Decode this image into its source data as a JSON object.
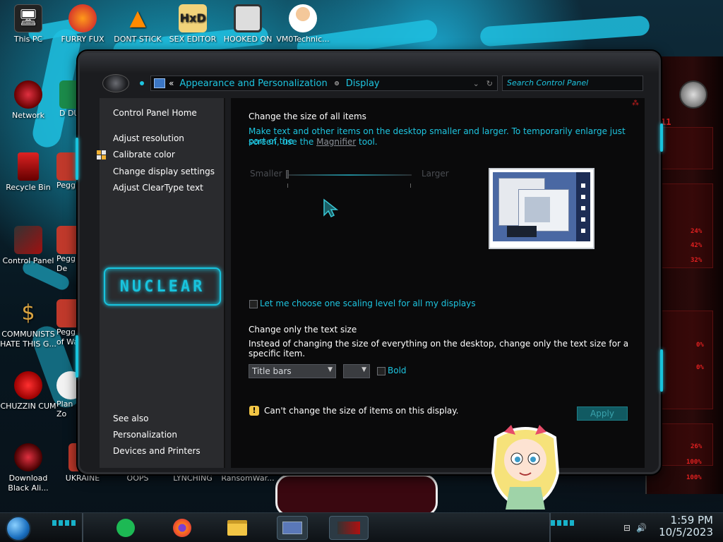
{
  "desktop": {
    "icons": [
      {
        "label": "This PC"
      },
      {
        "label": "FURRY FUX"
      },
      {
        "label": "DONT STICK"
      },
      {
        "label": "SEX EDITOR"
      },
      {
        "label": "HOOKED ON"
      },
      {
        "label": "VM0Technic..."
      },
      {
        "label": "Network"
      },
      {
        "label": "D DUM"
      },
      {
        "label": "Recycle Bin"
      },
      {
        "label": "Peggle"
      },
      {
        "label": "Control Panel"
      },
      {
        "label": "Peggle De"
      },
      {
        "label": "COMMUNISTS HATE THIS G..."
      },
      {
        "label": "Peggle of Wa"
      },
      {
        "label": "CHUZZIN CUM"
      },
      {
        "label": "Plan Zo"
      },
      {
        "label": "Download Black Ali..."
      },
      {
        "label": "UKRAINE"
      },
      {
        "label": "OOPS"
      },
      {
        "label": "LYNCHING"
      },
      {
        "label": "RansomWar..."
      }
    ],
    "wallpaper_readouts": [
      "24%",
      "42%",
      "32%",
      "0%",
      "0%",
      "26%",
      "100%",
      "100%"
    ],
    "wallpaper_number": "11"
  },
  "window": {
    "address": {
      "separator": "«",
      "crumb_1": "Appearance and Personalization",
      "crumb_2": "Display",
      "dropdown_glyph": "⌄",
      "refresh_glyph": "↻"
    },
    "search": {
      "placeholder": "Search Control Panel"
    },
    "sidebar": {
      "home": "Control Panel Home",
      "links": [
        "Adjust resolution",
        "Calibrate color",
        "Change display settings",
        "Adjust ClearType text"
      ],
      "logo_text": "NUCLEAR",
      "see_also_heading": "See also",
      "see_also": [
        "Personalization",
        "Devices and Printers"
      ]
    },
    "main": {
      "heading": "Change the size of all items",
      "desc_before": "Make text and other items on the desktop smaller and larger. To temporarily enlarge just part of the",
      "desc_line2_before": "screen, use the ",
      "desc_link": "Magnifier",
      "desc_after": " tool.",
      "slider": {
        "min_label": "Smaller",
        "max_label": "Larger",
        "value": 0
      },
      "checkbox_label": "Let me choose one scaling level for all my displays",
      "checkbox_checked": false,
      "text_size_heading": "Change only the text size",
      "text_size_desc": "Instead of changing the size of everything on the desktop, change only the text size for a specific item.",
      "item_select": "Title bars",
      "size_select": "",
      "bold_label": "Bold",
      "bold_checked": false,
      "warning": "Can't change the size of items on this display.",
      "apply": "Apply",
      "corner_mark": "⁂"
    }
  },
  "taskbar": {
    "time": "1:59 PM",
    "date": "10/5/2023",
    "apps": [
      "spotify-icon",
      "firefox-icon",
      "file-explorer-icon",
      "control-panel-icon",
      "display-icon"
    ],
    "colors": {
      "accent": "#1ec5e0",
      "alert": "#e02020"
    }
  }
}
